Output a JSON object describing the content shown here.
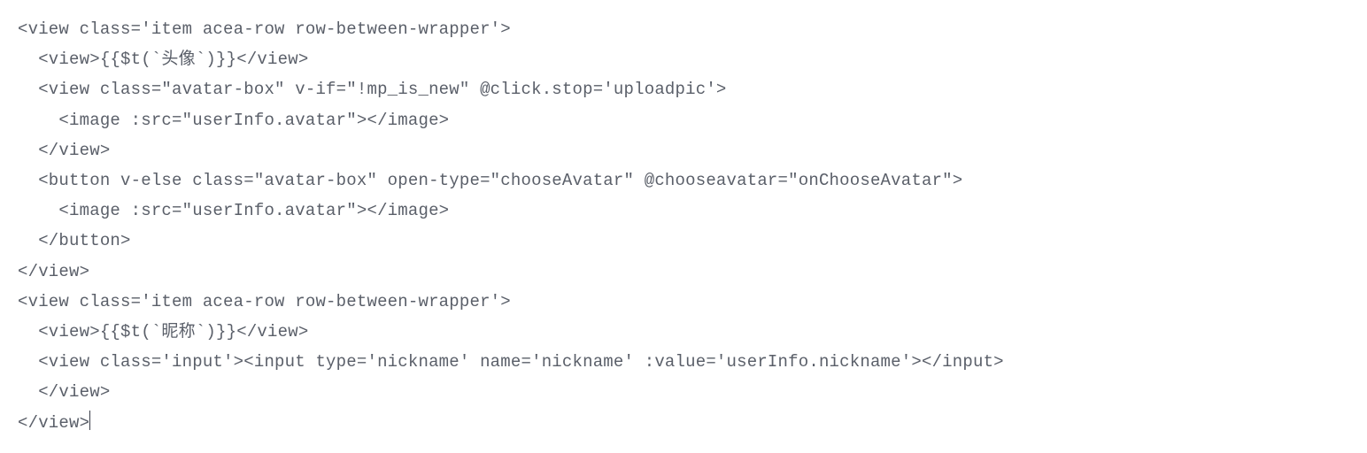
{
  "code": {
    "lines": [
      "<view class='item acea-row row-between-wrapper'>",
      "  <view>{{$t(`头像`)}}</view>",
      "  <view class=\"avatar-box\" v-if=\"!mp_is_new\" @click.stop='uploadpic'>",
      "    <image :src=\"userInfo.avatar\"></image>",
      "  </view>",
      "  <button v-else class=\"avatar-box\" open-type=\"chooseAvatar\" @chooseavatar=\"onChooseAvatar\">",
      "    <image :src=\"userInfo.avatar\"></image>",
      "  </button>",
      "</view>",
      "<view class='item acea-row row-between-wrapper'>",
      "  <view>{{$t(`昵称`)}}</view>",
      "  <view class='input'><input type='nickname' name='nickname' :value='userInfo.nickname'></input>",
      "  </view>",
      "</view>"
    ]
  }
}
